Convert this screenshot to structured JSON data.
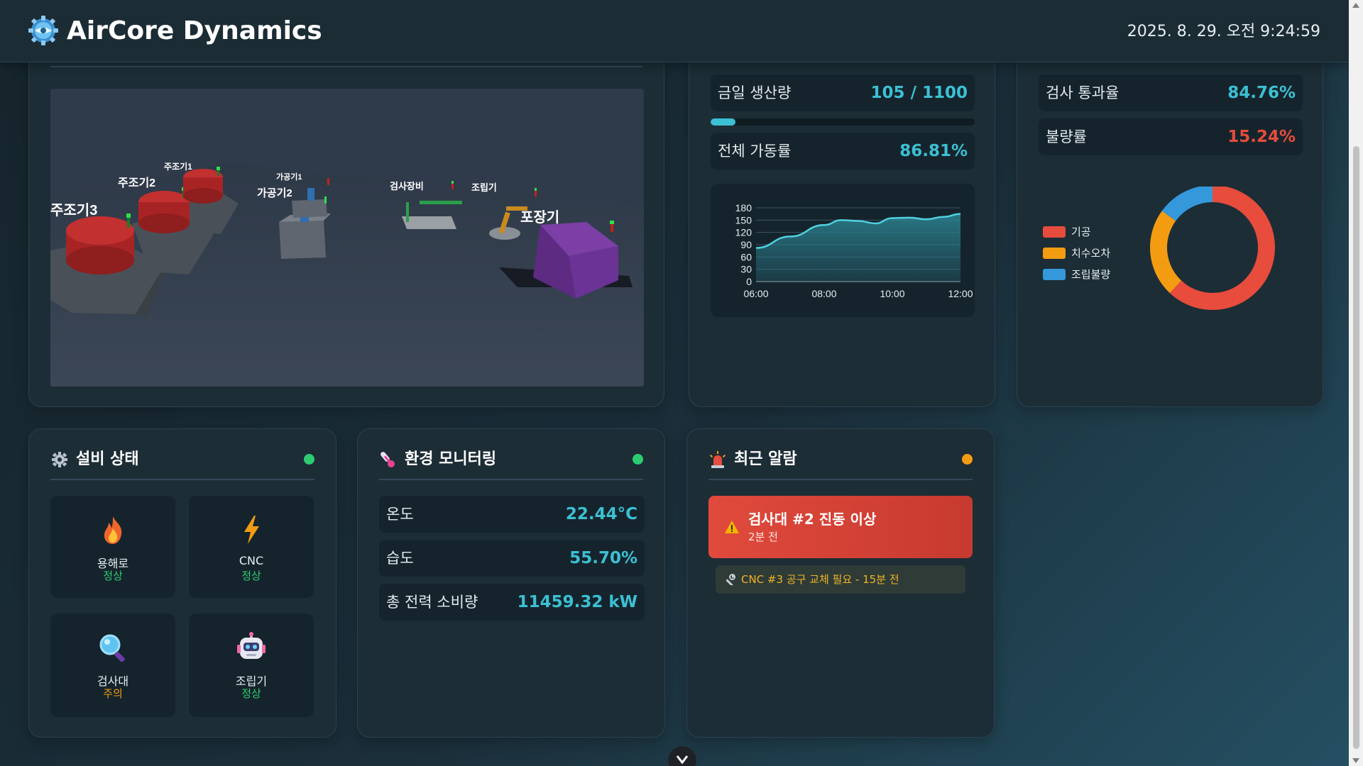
{
  "header": {
    "brand": "AirCore Dynamics",
    "datetime": "2025. 8. 29. 오전 9:24:59",
    "logo_icon": "gear-globe-icon"
  },
  "factory_view": {
    "labels": {
      "casting1": "주조기1",
      "casting2": "주조기2",
      "casting3": "주조기3",
      "machining1": "가공기1",
      "machining2": "가공기2",
      "inspection": "검사장비",
      "assembly": "조립기",
      "packaging": "포장기"
    }
  },
  "production": {
    "daily_label": "금일 생산량",
    "daily_value": "105 / 1100",
    "progress": 0.095,
    "utilization_label": "전체 가동률",
    "utilization_value": "86.81%"
  },
  "chart_data": [
    {
      "type": "area",
      "title": "",
      "x": [
        "06:00",
        "07:00",
        "08:00",
        "08:30",
        "09:00",
        "09:30",
        "10:00",
        "10:30",
        "11:00",
        "11:30",
        "12:00"
      ],
      "x_ticks": [
        "06:00",
        "08:00",
        "10:00",
        "12:00"
      ],
      "y_ticks": [
        "180",
        "150",
        "120",
        "90",
        "60",
        "30",
        "0"
      ],
      "series": [
        {
          "values": [
            82,
            110,
            138,
            150,
            148,
            142,
            155,
            156,
            152,
            158,
            165
          ]
        }
      ],
      "ylim": [
        0,
        180
      ],
      "grid": true,
      "colors": {
        "line": "#4fd1e0",
        "fill": "#2b7f8d"
      }
    },
    {
      "type": "pie",
      "title": "",
      "categories": [
        "기공",
        "치수오차",
        "조립불량"
      ],
      "values": [
        62,
        23,
        15
      ],
      "legend": "left",
      "colors": [
        "#e74c3c",
        "#f39c12",
        "#3498db"
      ]
    }
  ],
  "quality": {
    "pass_label": "검사 통과율",
    "pass_value": "84.76%",
    "defect_label": "불량률",
    "defect_value": "15.24%",
    "legend": [
      "기공",
      "치수오차",
      "조립불량"
    ]
  },
  "equipment": {
    "title": "설비 상태",
    "items": [
      {
        "name": "용해로",
        "status": "정상",
        "icon": "fire-icon"
      },
      {
        "name": "CNC",
        "status": "정상",
        "icon": "lightning-icon"
      },
      {
        "name": "검사대",
        "status": "주의",
        "icon": "magnifier-icon"
      },
      {
        "name": "조립기",
        "status": "정상",
        "icon": "robot-icon"
      }
    ]
  },
  "environment": {
    "title": "환경 모니터링",
    "temp_label": "온도",
    "temp_value": "22.44°C",
    "humidity_label": "습도",
    "humidity_value": "55.70%",
    "power_label": "총 전력 소비량",
    "power_value": "11459.32 kW"
  },
  "alarms": {
    "title": "최근 알람",
    "critical_title": "검사대 #2 진동 이상",
    "critical_time": "2분 전",
    "info_text": "CNC #3 공구 교체 필요 - 15분 전"
  },
  "colors": {
    "accent": "#3cc0d4",
    "ok": "#2ecc71",
    "warn": "#f39c12",
    "danger": "#e74c3c"
  }
}
